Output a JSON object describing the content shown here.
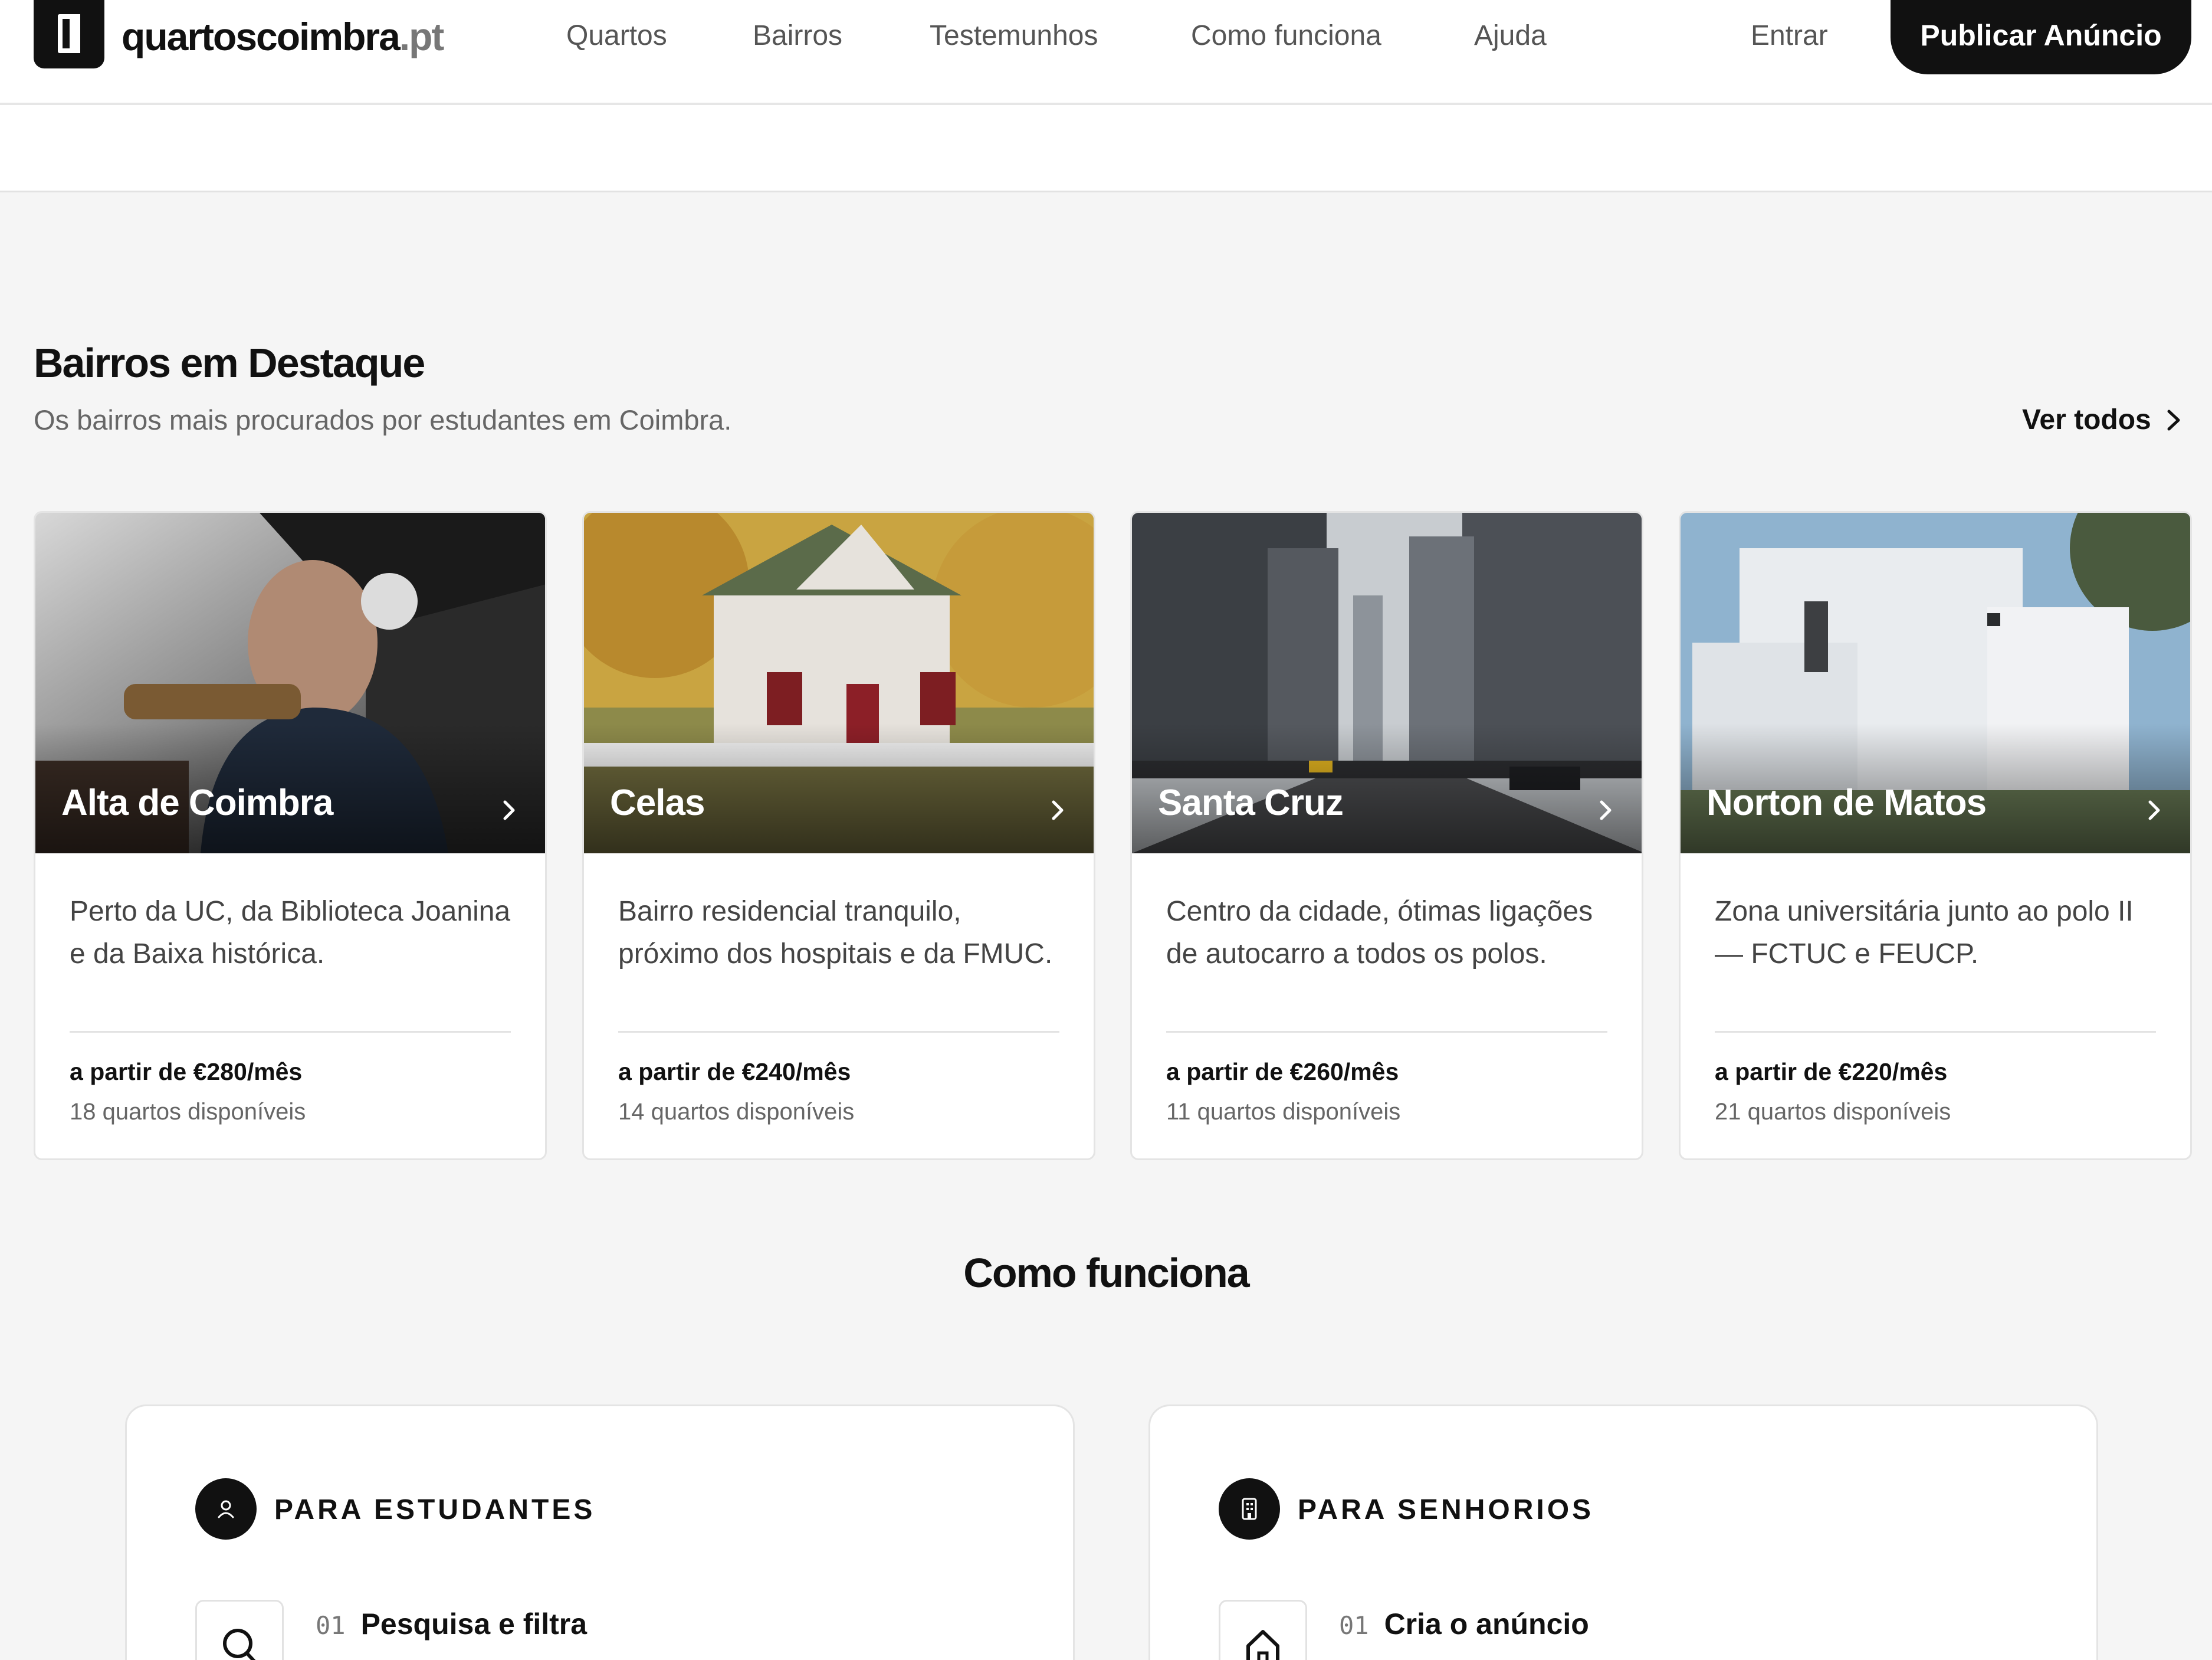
{
  "header": {
    "logo_main": "quartoscoimbra",
    "logo_tld": ".pt",
    "nav": [
      "Quartos",
      "Bairros",
      "Testemunhos",
      "Como funciona",
      "Ajuda"
    ],
    "signin_label": "Entrar",
    "publish_label": "Publicar Anúncio"
  },
  "featured": {
    "title": "Bairros em Destaque",
    "subtitle": "Os bairros mais procurados por estudantes em Coimbra.",
    "see_all_label": "Ver todos",
    "cards": [
      {
        "name": "Alta de Coimbra",
        "description": "Perto da UC, da Biblioteca Joanina e da Baixa histórica.",
        "price": "a partir de €280/mês",
        "count": "18 quartos disponíveis"
      },
      {
        "name": "Celas",
        "description": "Bairro residencial tranquilo, próximo dos hospitais e da FMUC.",
        "price": "a partir de €240/mês",
        "count": "14 quartos disponíveis"
      },
      {
        "name": "Santa Cruz",
        "description": "Centro da cidade, ótimas ligações de autocarro a todos os polos.",
        "price": "a partir de €260/mês",
        "count": "11 quartos disponíveis"
      },
      {
        "name": "Norton de Matos",
        "description": "Zona universitária junto ao polo II — FCTUC e FEUCP.",
        "price": "a partir de €220/mês",
        "count": "21 quartos disponíveis"
      }
    ]
  },
  "how_it_works": {
    "title": "Como funciona",
    "students": {
      "label": "PARA ESTUDANTES",
      "icon": "user-icon",
      "first_step": {
        "num": "01",
        "title": "Pesquisa e filtra",
        "icon": "search-icon"
      }
    },
    "landlords": {
      "label": "PARA SENHORIOS",
      "icon": "building-icon",
      "first_step": {
        "num": "01",
        "title": "Cria o anúncio",
        "icon": "home-icon"
      }
    }
  }
}
